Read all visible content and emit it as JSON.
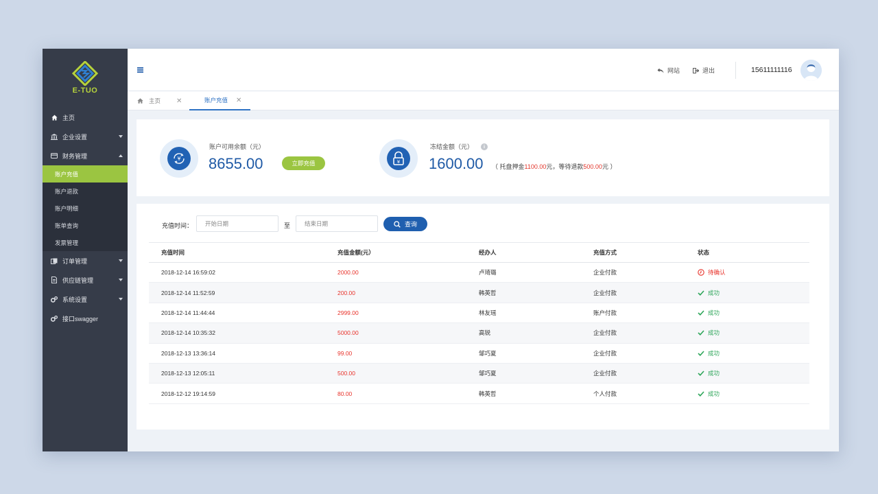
{
  "app": {
    "logo_text": "E-TUO"
  },
  "sidebar": {
    "items": [
      {
        "label": "主页",
        "icon": "home-icon"
      },
      {
        "label": "企业设置",
        "icon": "bank-icon"
      },
      {
        "label": "财务管理",
        "icon": "card-icon"
      }
    ],
    "finance_sub": [
      "账户充值",
      "账户退款",
      "账户明细",
      "账单查询",
      "发票管理"
    ],
    "items_after": [
      {
        "label": "订单管理",
        "icon": "orders-icon"
      },
      {
        "label": "供应链管理",
        "icon": "document-icon"
      },
      {
        "label": "系统设置",
        "icon": "gears-icon"
      },
      {
        "label": "接口swagger",
        "icon": "gears-icon"
      }
    ]
  },
  "header": {
    "website_label": "网站",
    "logout_label": "退出",
    "username": "15611111116"
  },
  "tabs": [
    {
      "label": "主页"
    },
    {
      "label": "账户充值"
    }
  ],
  "balance": {
    "available_label": "账户可用余额（元）",
    "available_value": "8655.00",
    "recharge_button": "立即充值",
    "frozen_label": "冻结金额（元）",
    "frozen_value": "1600.00",
    "note_prefix": "（ 托盘押金",
    "note_deposit": "1100.00",
    "note_middle": "元，等待退款",
    "note_refund": "500.00",
    "note_suffix": "元 ）"
  },
  "filter": {
    "label": "充值时间：",
    "start_placeholder": "开始日期",
    "to_label": "至",
    "end_placeholder": "结束日期",
    "search_button": "查询"
  },
  "table": {
    "headers": [
      "充值时间",
      "充值金额(元）",
      "经办人",
      "充值方式",
      "状态"
    ],
    "rows": [
      {
        "time": "2018-12-14 16:59:02",
        "amount": "2000.00",
        "operator": "卢琦璐",
        "method": "企业付款",
        "status": "待确认",
        "ok": false
      },
      {
        "time": "2018-12-14 11:52:59",
        "amount": "200.00",
        "operator": "韩英哲",
        "method": "企业付款",
        "status": "成功",
        "ok": true
      },
      {
        "time": "2018-12-14 11:44:44",
        "amount": "2999.00",
        "operator": "林友瑶",
        "method": "账户付款",
        "status": "成功",
        "ok": true
      },
      {
        "time": "2018-12-14 10:35:32",
        "amount": "5000.00",
        "operator": "高锐",
        "method": "企业付款",
        "status": "成功",
        "ok": true
      },
      {
        "time": "2018-12-13 13:36:14",
        "amount": "99.00",
        "operator": "邹巧夏",
        "method": "企业付款",
        "status": "成功",
        "ok": true
      },
      {
        "time": "2018-12-13 12:05:11",
        "amount": "500.00",
        "operator": "邹巧夏",
        "method": "企业付款",
        "status": "成功",
        "ok": true
      },
      {
        "time": "2018-12-12 19:14:59",
        "amount": "80.00",
        "operator": "韩英哲",
        "method": "个人付款",
        "status": "成功",
        "ok": true
      }
    ]
  },
  "colors": {
    "sidebar_bg": "#363c49",
    "active_green": "#9bc541",
    "primary_blue": "#1f5faf",
    "amount_red": "#e8322a",
    "success_green": "#2ea65a"
  }
}
